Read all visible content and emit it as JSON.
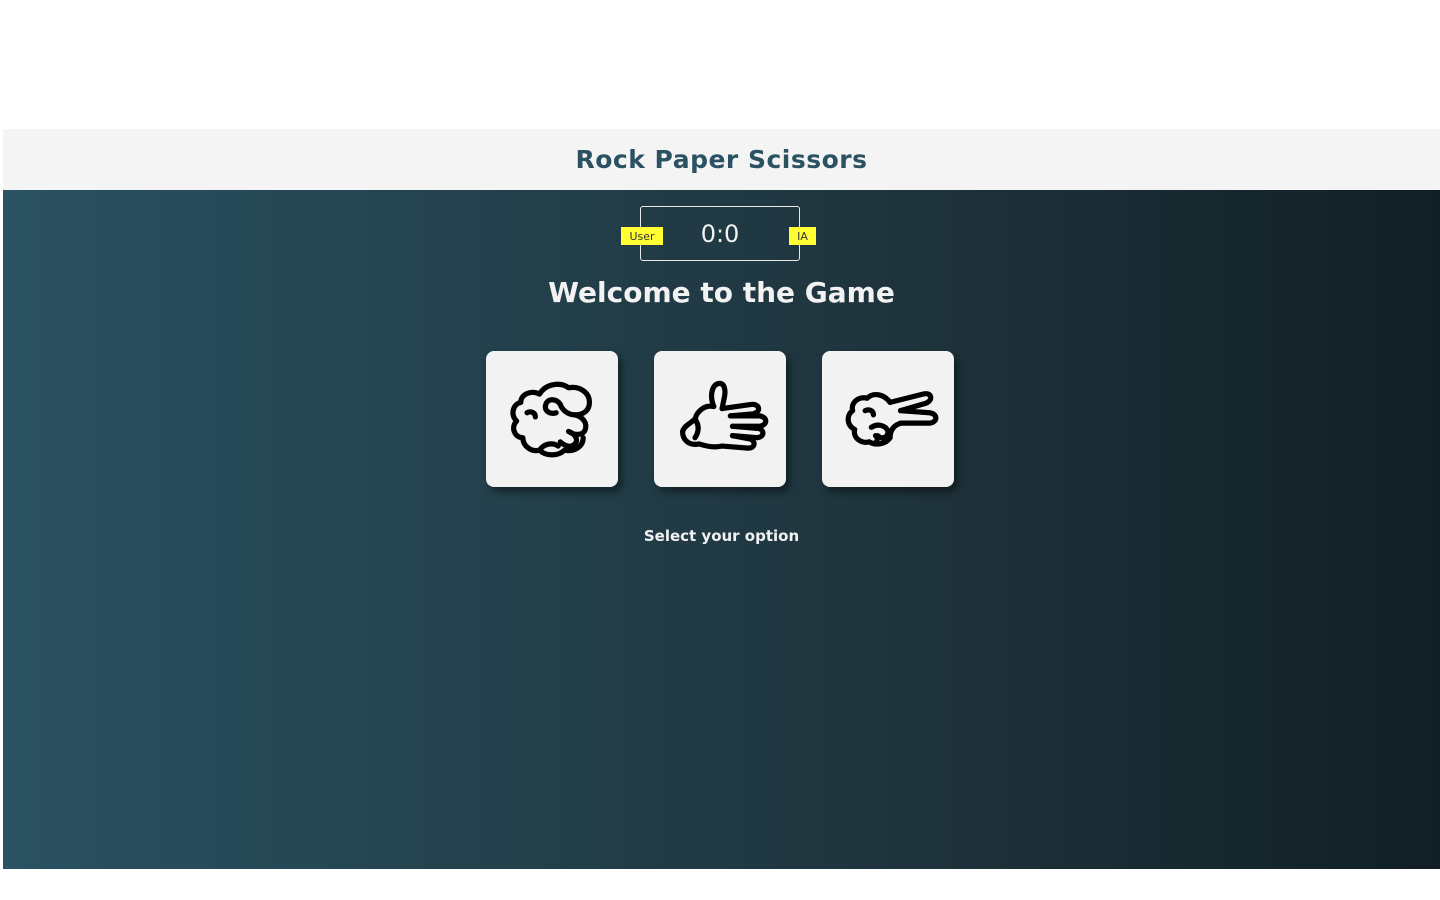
{
  "header": {
    "title": "Rock Paper Scissors"
  },
  "scoreboard": {
    "score": "0:0",
    "user_label": "User",
    "ai_label": "IA"
  },
  "main": {
    "heading": "Welcome to the Game",
    "hint": "Select your option"
  },
  "choices": [
    {
      "name": "rock",
      "icon": "rock-hand-icon"
    },
    {
      "name": "paper",
      "icon": "paper-hand-icon"
    },
    {
      "name": "scissors",
      "icon": "scissors-hand-icon"
    }
  ],
  "colors": {
    "header_bg": "#f4f4f4",
    "title": "#2a5262",
    "gradient_start": "#2a5262",
    "gradient_end": "#111f25",
    "badge": "#ffff33",
    "card": "#f2f2f2",
    "text": "#f2f2f2"
  }
}
